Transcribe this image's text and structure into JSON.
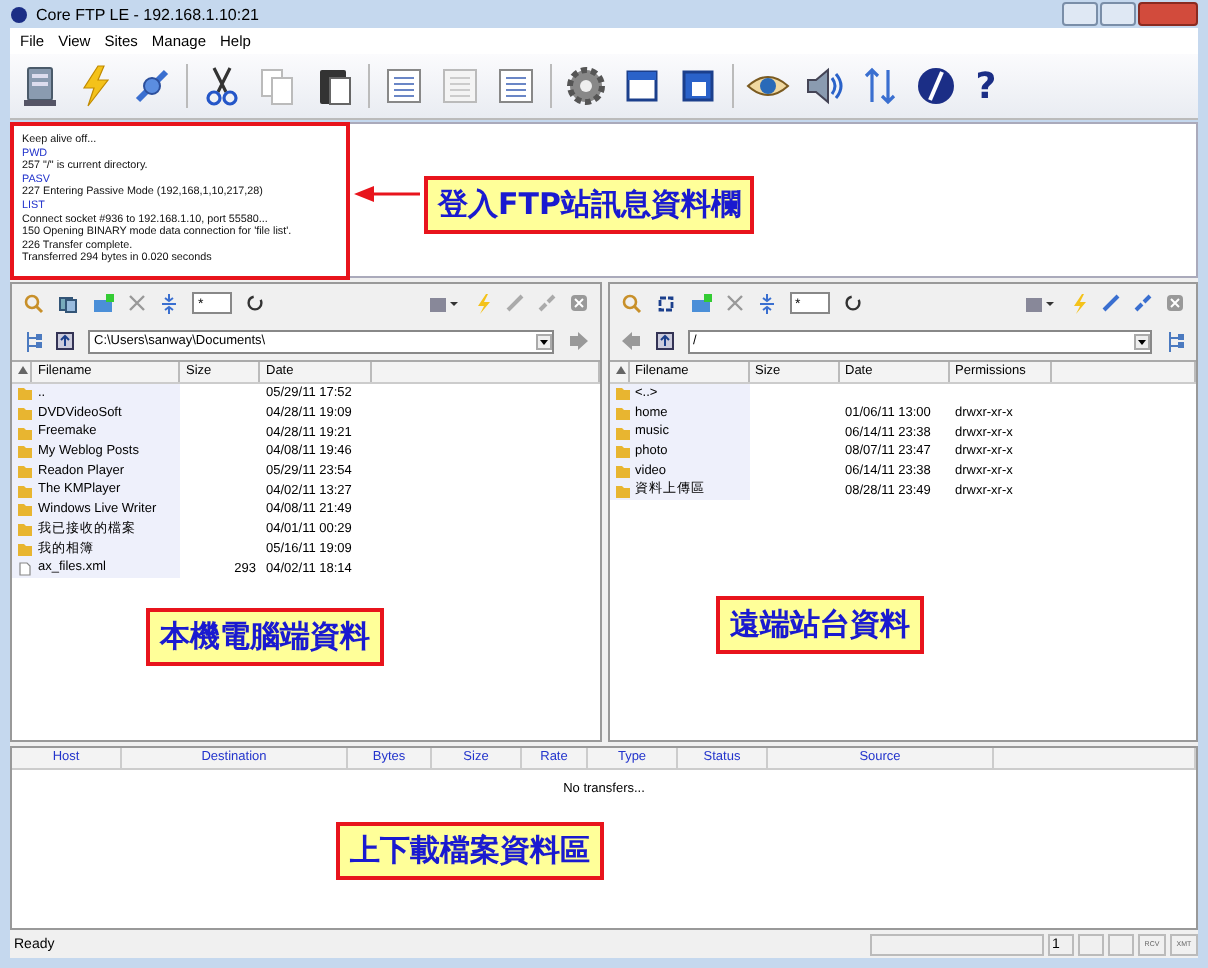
{
  "window": {
    "title": "Core FTP LE - 192.168.1.10:21"
  },
  "menu": [
    "File",
    "View",
    "Sites",
    "Manage",
    "Help"
  ],
  "toolbar": {
    "help_glyph": "?"
  },
  "log": {
    "lines": [
      {
        "text": "Keep alive off...",
        "kind": "reply"
      },
      {
        "text": "PWD",
        "kind": "command"
      },
      {
        "text": "257 \"/\" is current directory.",
        "kind": "reply"
      },
      {
        "text": "PASV",
        "kind": "command"
      },
      {
        "text": "227 Entering Passive Mode (192,168,1,10,217,28)",
        "kind": "reply"
      },
      {
        "text": "LIST",
        "kind": "command"
      },
      {
        "text": "Connect socket #936 to 192.168.1.10, port 55580...",
        "kind": "reply"
      },
      {
        "text": "150 Opening BINARY mode data connection for 'file list'.",
        "kind": "reply"
      },
      {
        "text": "226 Transfer complete.",
        "kind": "reply"
      },
      {
        "text": "Transferred 294 bytes in 0.020 seconds",
        "kind": "reply"
      }
    ]
  },
  "local_pane": {
    "filter": "*",
    "path": "C:\\Users\\sanway\\Documents\\",
    "columns": [
      "Filename",
      "Size",
      "Date"
    ],
    "rows": [
      {
        "kind": "folder",
        "name": "..",
        "size": "",
        "date": "05/29/11  17:52"
      },
      {
        "kind": "folder",
        "name": "DVDVideoSoft",
        "size": "",
        "date": "04/28/11  19:09"
      },
      {
        "kind": "folder",
        "name": "Freemake",
        "size": "",
        "date": "04/28/11  19:21"
      },
      {
        "kind": "folder",
        "name": "My Weblog Posts",
        "size": "",
        "date": "04/08/11  19:46"
      },
      {
        "kind": "folder",
        "name": "Readon Player",
        "size": "",
        "date": "05/29/11  23:54"
      },
      {
        "kind": "folder",
        "name": "The KMPlayer",
        "size": "",
        "date": "04/02/11  13:27"
      },
      {
        "kind": "folder",
        "name": "Windows Live Writer",
        "size": "",
        "date": "04/08/11  21:49"
      },
      {
        "kind": "folder",
        "name": "我已接收的檔案",
        "size": "",
        "date": "04/01/11  00:29"
      },
      {
        "kind": "folder",
        "name": "我的相簿",
        "size": "",
        "date": "05/16/11  19:09"
      },
      {
        "kind": "file",
        "name": "ax_files.xml",
        "size": "293",
        "date": "04/02/11  18:14"
      }
    ]
  },
  "remote_pane": {
    "filter": "*",
    "path": "/",
    "columns": [
      "Filename",
      "Size",
      "Date",
      "Permissions"
    ],
    "rows": [
      {
        "kind": "folder",
        "name": "<..>",
        "size": "",
        "date": "",
        "permissions": ""
      },
      {
        "kind": "folder",
        "name": "home",
        "size": "",
        "date": "01/06/11  13:00",
        "permissions": "drwxr-xr-x"
      },
      {
        "kind": "folder",
        "name": "music",
        "size": "",
        "date": "06/14/11  23:38",
        "permissions": "drwxr-xr-x"
      },
      {
        "kind": "folder",
        "name": "photo",
        "size": "",
        "date": "08/07/11  23:47",
        "permissions": "drwxr-xr-x"
      },
      {
        "kind": "folder",
        "name": "video",
        "size": "",
        "date": "06/14/11  23:38",
        "permissions": "drwxr-xr-x"
      },
      {
        "kind": "folder",
        "name": "資料上傳區",
        "size": "",
        "date": "08/28/11  23:49",
        "permissions": "drwxr-xr-x"
      }
    ]
  },
  "transfers": {
    "columns": [
      "Host",
      "Destination",
      "Bytes",
      "Size",
      "Rate",
      "Type",
      "Status",
      "Source"
    ],
    "empty_message": "No transfers..."
  },
  "status_bar": {
    "text": "Ready",
    "counter": "1",
    "indicators": [
      "RCV",
      "XMT"
    ]
  },
  "annotations": [
    {
      "kind": "arrow",
      "text": "登入FTP站訊息資料欄"
    },
    {
      "kind": "plain",
      "text": "本機電腦端資料"
    },
    {
      "kind": "plain",
      "text": "遠端站台資料"
    },
    {
      "kind": "plain",
      "text": "上下載檔案資料區"
    }
  ]
}
